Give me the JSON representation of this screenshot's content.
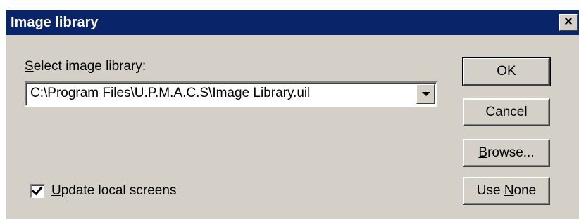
{
  "window": {
    "title": "Image library",
    "close_glyph": "×"
  },
  "form": {
    "library_label_accel": "S",
    "library_label_rest": "elect image library:",
    "library_value": "C:\\Program Files\\U.P.M.A.C.S\\Image Library.uil",
    "update_label_accel": "U",
    "update_label_rest": "pdate local screens",
    "update_checked": true
  },
  "buttons": {
    "ok": "OK",
    "cancel": "Cancel",
    "browse_accel": "B",
    "browse_rest": "rowse...",
    "use_none_prefix": "Use ",
    "use_none_accel": "N",
    "use_none_rest": "one"
  },
  "colors": {
    "titlebar": "#0a246a",
    "face": "#d4d0c8"
  },
  "icons": {
    "close": "close-icon",
    "dropdown": "chevron-down-icon",
    "check": "checkmark-icon"
  }
}
